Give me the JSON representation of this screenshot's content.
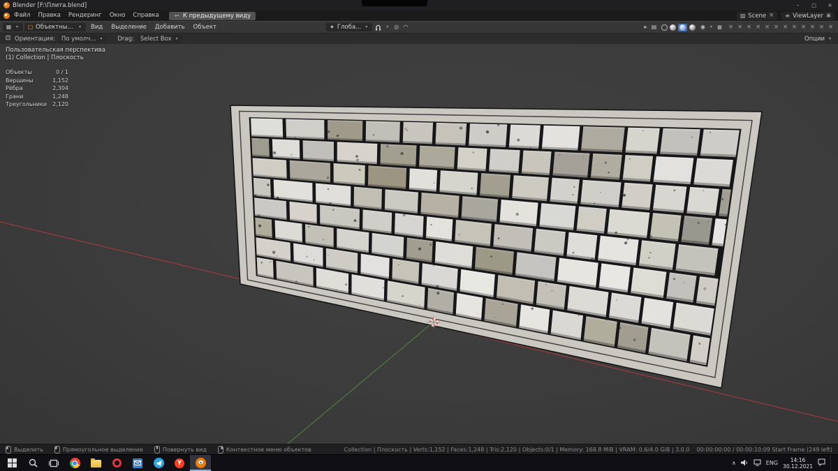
{
  "window": {
    "title": "Blender [F:\\Плита.blend]"
  },
  "topbar": {
    "menus": [
      "Файл",
      "Правка",
      "Рендеринг",
      "Окно",
      "Справка"
    ],
    "back_button": "К предыдущему виду",
    "scene": "Scene",
    "view_layer": "ViewLayer"
  },
  "header": {
    "mode": "Объектный режим",
    "menus": [
      "Вид",
      "Выделение",
      "Добавить",
      "Объект"
    ],
    "orientation": "Глоба..."
  },
  "tool_settings": {
    "orientation_label": "Ориентация:",
    "orientation_value": "По умолч...",
    "drag_label": "Drag:",
    "drag_value": "Select Box",
    "options": "Опции"
  },
  "viewport": {
    "view_label": "Пользовательская перспектива",
    "context_label": "(1) Collection | Плоскость",
    "stats": [
      {
        "label": "Объекты",
        "value": "0 / 1"
      },
      {
        "label": "Вершины",
        "value": "1,152"
      },
      {
        "label": "Рёбра",
        "value": "2,304"
      },
      {
        "label": "Грани",
        "value": "1,248"
      },
      {
        "label": "Треугольники",
        "value": "2,120"
      }
    ]
  },
  "scene": {
    "axis_x_color": "#a03c40",
    "axis_y_color": "#52803a",
    "slab_light": "#cac8c0",
    "slab_dark": "#17171a",
    "accent": "#4772b3"
  },
  "status_bar": {
    "hints": [
      {
        "label": "Выделить",
        "button": "left"
      },
      {
        "label": "Прямоугольное выделение",
        "button": "left"
      },
      {
        "label": "Повернуть вид",
        "button": "middle"
      },
      {
        "label": "Контекстное меню объектов",
        "button": "right"
      }
    ],
    "info": "Collection | Плоскость | Verts:1,152 | Faces:1,248 | Tris:2,120 | Objects:0/1 | Memory: 168.8 MiB | VRAM: 0.6/4.0 GiB | 3.0.0",
    "recorder": "00:00:00:00 / 00:00:10:09 Start Frame (249 left)"
  },
  "taskbar": {
    "language": "ENG",
    "time": "14:16",
    "date": "30.12.2021"
  }
}
